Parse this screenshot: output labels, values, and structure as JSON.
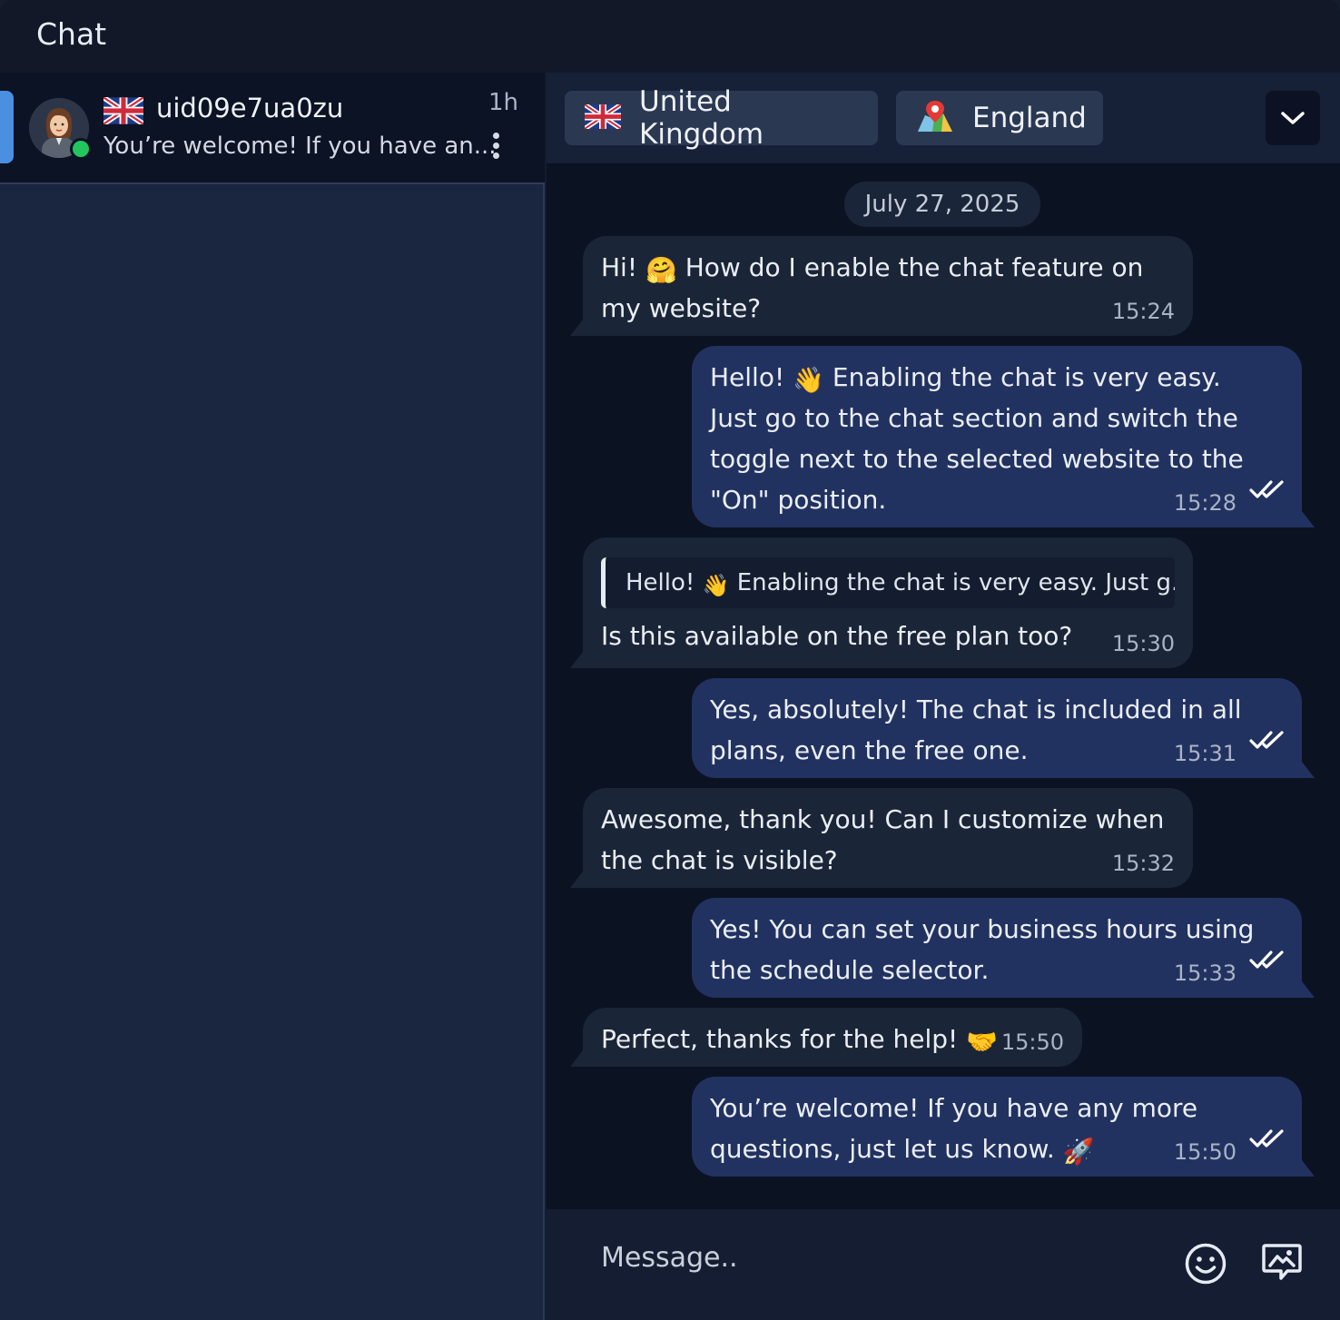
{
  "app": {
    "title": "Chat"
  },
  "sidebar": {
    "conversations": [
      {
        "username": "uid09e7ua0zu",
        "time_ago": "1h",
        "preview": "You’re welcome! If you have an...",
        "status": "online"
      }
    ]
  },
  "chat_header": {
    "country": "United Kingdom",
    "region": "England"
  },
  "date_separator": "July 27, 2025",
  "messages": [
    {
      "direction": "in",
      "text": "Hi! 🤗 How do I enable the chat feature on my website?",
      "line1": "Hi! ",
      "emoji1": "🤗",
      "line1b": " How do I enable the chat feature on",
      "line2": "my website?",
      "time": "15:24"
    },
    {
      "direction": "out",
      "line1": "Hello! ",
      "emoji1": "👋",
      "line1b": " Enabling the chat is very easy.",
      "line2": "Just go to the chat section and switch the",
      "line3": "toggle next to the selected website to the",
      "line4": "\"On\" position.",
      "time": "15:28",
      "status": "read"
    },
    {
      "direction": "in",
      "quote_a": "Hello! ",
      "quote_emoji": "👋",
      "quote_b": " Enabling the chat is very easy. Just g...",
      "line1": "Is this available on the free plan too?",
      "time": "15:30"
    },
    {
      "direction": "out",
      "line1": "Yes, absolutely! The chat is included in all",
      "line2": "plans, even the free one.",
      "time": "15:31",
      "status": "read"
    },
    {
      "direction": "in",
      "line1": "Awesome, thank you! Can I customize when",
      "line2": "the chat is visible?",
      "time": "15:32"
    },
    {
      "direction": "out",
      "line1": "Yes! You can set your business hours using",
      "line2": "the schedule selector.",
      "time": "15:33",
      "status": "read"
    },
    {
      "direction": "in",
      "line1": "Perfect, thanks for the help! ",
      "emoji1": "🤝",
      "time": "15:50"
    },
    {
      "direction": "out",
      "line1": "You’re welcome! If you have any more",
      "line2": "questions, just let us know. ",
      "emoji2": "🚀",
      "time": "15:50",
      "status": "read"
    }
  ],
  "composer": {
    "placeholder": "Message.."
  },
  "icons": {
    "uk_flag": "uk-flag-icon",
    "map": "map-pin-icon",
    "chevron": "chevron-down-icon",
    "emoji": "smiley-icon",
    "media": "image-message-icon",
    "read": "double-check-icon"
  },
  "colors": {
    "accent": "#4a8fe0",
    "online": "#22c55e",
    "incoming_bubble": "#1b2538",
    "outgoing_bubble": "#223260"
  }
}
